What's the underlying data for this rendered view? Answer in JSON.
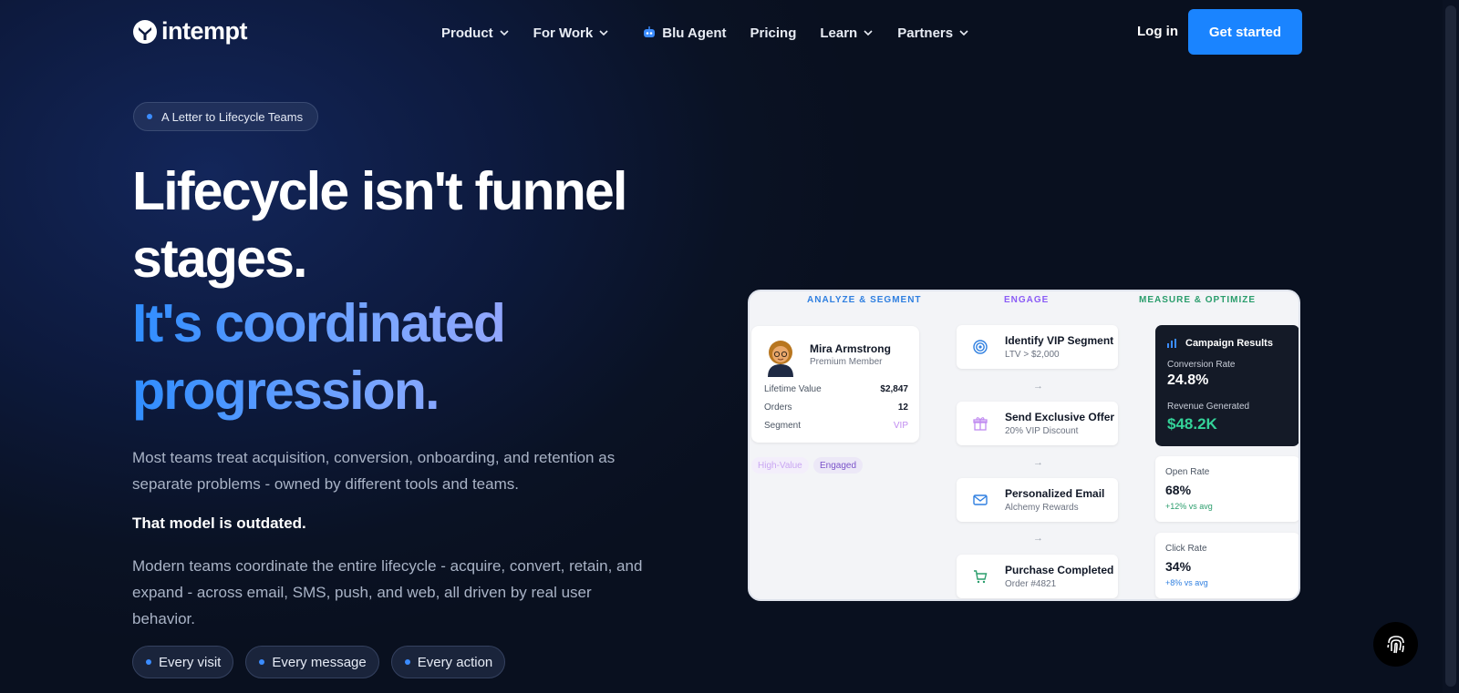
{
  "header": {
    "logo_text": "intempt",
    "nav": [
      {
        "label": "Product",
        "has_dropdown": true
      },
      {
        "label": "For Work",
        "has_dropdown": true
      },
      {
        "label": "Blu Agent",
        "has_dropdown": false,
        "icon": "robot-icon"
      },
      {
        "label": "Pricing",
        "has_dropdown": false
      },
      {
        "label": "Learn",
        "has_dropdown": true
      },
      {
        "label": "Partners",
        "has_dropdown": true
      }
    ],
    "login_label": "Log in",
    "cta_label": "Get started"
  },
  "hero": {
    "pill_label": "A Letter to Lifecycle Teams",
    "headline_line1": "Lifecycle isn't funnel stages.",
    "headline_line2": "It's coordinated progression.",
    "para1": "Most teams treat acquisition, conversion, onboarding, and retention as separate problems - owned by different tools and teams.",
    "para2": "That model is outdated.",
    "para3": "Modern teams coordinate the entire lifecycle - acquire, convert, retain, and expand - across email, SMS, push, and web, all driven by real user behavior.",
    "tags": [
      "Every visit",
      "Every message",
      "Every action"
    ]
  },
  "dashboard": {
    "columns": [
      "ANALYZE & SEGMENT",
      "ENGAGE",
      "MEASURE & OPTIMIZE"
    ],
    "profile": {
      "name": "Mira Armstrong",
      "subtitle": "Premium Member",
      "rows": [
        {
          "label": "Lifetime Value",
          "value": "$2,847"
        },
        {
          "label": "Orders",
          "value": "12"
        },
        {
          "label": "Segment",
          "value": "VIP"
        }
      ],
      "chips": [
        "High-Value",
        "Engaged"
      ]
    },
    "steps": [
      {
        "title": "Identify VIP Segment",
        "sub": "LTV > $2,000",
        "icon": "target-icon"
      },
      {
        "title": "Send Exclusive Offer",
        "sub": "20% VIP Discount",
        "icon": "gift-icon"
      },
      {
        "title": "Personalized Email",
        "sub": "Alchemy Rewards",
        "icon": "mail-icon"
      },
      {
        "title": "Purchase Completed",
        "sub": "Order #4821",
        "icon": "cart-icon"
      }
    ],
    "results": {
      "title": "Campaign Results",
      "conv_label": "Conversion Rate",
      "conv_value": "24.8%",
      "rev_label": "Revenue Generated",
      "rev_value": "$48.2K"
    },
    "metrics": [
      {
        "label": "Open Rate",
        "value": "68%",
        "delta": "+12% vs avg"
      },
      {
        "label": "Click Rate",
        "value": "34%",
        "delta": "+8% vs avg"
      }
    ]
  },
  "colors": {
    "accent": "#1a84ff",
    "analyze": "#2f7fe0",
    "engage": "#8b5cf6",
    "measure": "#2a9d6c"
  }
}
